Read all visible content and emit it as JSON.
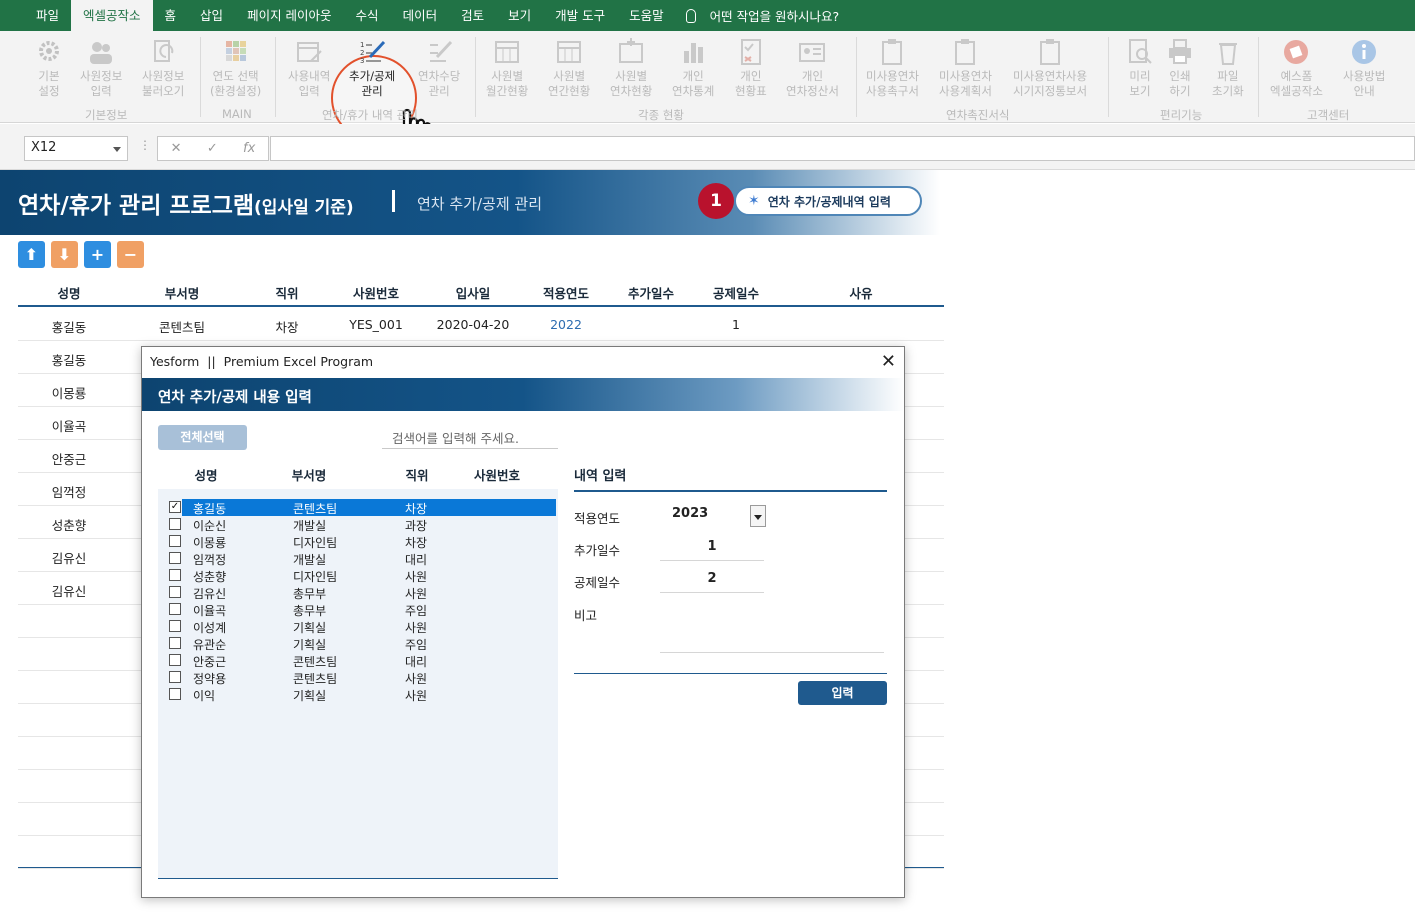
{
  "menu": {
    "tabs": [
      "파일",
      "엑셀공작소",
      "홈",
      "삽입",
      "페이지 레이아웃",
      "수식",
      "데이터",
      "검토",
      "보기",
      "개발 도구",
      "도움말"
    ],
    "tell_me": "어떤 작업을 원하시나요?"
  },
  "ribbon": {
    "btn_basic": [
      "기본",
      "설정"
    ],
    "btn_emp_input": [
      "사원정보",
      "입력"
    ],
    "btn_emp_load": [
      "사원정보",
      "불러오기"
    ],
    "btn_year": [
      "연도 선택",
      "(환경설정)"
    ],
    "btn_usage": [
      "사용내역",
      "입력"
    ],
    "btn_add": [
      "추가/공제",
      "관리"
    ],
    "btn_count": [
      "연차수당",
      "관리"
    ],
    "btn_monthly": [
      "사원별",
      "월간현황"
    ],
    "btn_yearly": [
      "사원별",
      "연간현황"
    ],
    "btn_annual": [
      "사원별",
      "연차현황"
    ],
    "btn_stats": [
      "개인",
      "연차통계"
    ],
    "btn_status": [
      "개인",
      "현황표"
    ],
    "btn_settle": [
      "개인",
      "연차정산서"
    ],
    "btn_claim": [
      "미사용연차",
      "사용촉구서"
    ],
    "btn_plan": [
      "미사용연차",
      "사용계획서"
    ],
    "btn_notice": [
      "미사용연차사용",
      "시기지정통보서"
    ],
    "btn_preview": [
      "미리",
      "보기"
    ],
    "btn_print": [
      "인쇄",
      "하기"
    ],
    "btn_reset": [
      "파일",
      "초기화"
    ],
    "btn_shop": [
      "예스폼",
      "엑셀공작소"
    ],
    "btn_guide": [
      "사용방법",
      "안내"
    ],
    "groups": {
      "basic": "기본정보",
      "main": "MAIN",
      "leave": "연차/휴가 내역 관리",
      "status": "각종 현황",
      "promo": "연차촉진서식",
      "util": "편리기능",
      "cs": "고객센터"
    }
  },
  "formula": {
    "namebox": "X12",
    "cancel": "✕",
    "enter": "✓",
    "fx": "fx",
    "value": ""
  },
  "header": {
    "title": "연차/휴가 관리 프로그램",
    "title_sub": "(입사일 기준)",
    "subtitle": "연차 추가/공제 관리",
    "badge": "1",
    "button": "연차 추가/공제내역 입력"
  },
  "icons": {
    "up": "arrow-up-icon",
    "down": "arrow-down-icon",
    "plus": "plus-icon",
    "minus": "minus-icon"
  },
  "colors": {
    "excel_green": "#217346",
    "navy": "#1f5a8e",
    "badge_red": "#b9122d",
    "callout": "#e2512c"
  },
  "table": {
    "columns": [
      "성명",
      "부서명",
      "직위",
      "사원번호",
      "입사일",
      "적용연도",
      "추가일수",
      "공제일수",
      "사유"
    ],
    "rows": [
      {
        "name": "홍길동",
        "dept": "콘텐츠팀",
        "pos": "차장",
        "id": "YES_001",
        "join": "2020-04-20",
        "year": "2022",
        "add": "",
        "sub": "1",
        "reason": ""
      },
      {
        "name": "홍길동"
      },
      {
        "name": "이몽룡"
      },
      {
        "name": "이율곡"
      },
      {
        "name": "안중근"
      },
      {
        "name": "임꺽정"
      },
      {
        "name": "성춘향"
      },
      {
        "name": "김유신"
      },
      {
        "name": "김유신"
      }
    ]
  },
  "dialog": {
    "title": "Yesform  ||  Premium Excel Program",
    "close": "✕",
    "heading": "연차 추가/공제 내용 입력",
    "select_all": "전체선택",
    "search_placeholder": "검색어를 입력해 주세요.",
    "list_columns": [
      "성명",
      "부서명",
      "직위",
      "사원번호"
    ],
    "employees": [
      {
        "name": "홍길동",
        "dept": "콘텐츠팀",
        "pos": "차장",
        "checked": true
      },
      {
        "name": "이순신",
        "dept": "개발실",
        "pos": "과장"
      },
      {
        "name": "이몽룡",
        "dept": "디자인팀",
        "pos": "차장"
      },
      {
        "name": "임꺽정",
        "dept": "개발실",
        "pos": "대리"
      },
      {
        "name": "성춘향",
        "dept": "디자인팀",
        "pos": "사원"
      },
      {
        "name": "김유신",
        "dept": "총무부",
        "pos": "사원"
      },
      {
        "name": "이율곡",
        "dept": "총무부",
        "pos": "주임"
      },
      {
        "name": "이성계",
        "dept": "기획실",
        "pos": "사원"
      },
      {
        "name": "유관순",
        "dept": "기획실",
        "pos": "주임"
      },
      {
        "name": "안중근",
        "dept": "콘텐츠팀",
        "pos": "대리"
      },
      {
        "name": "정약용",
        "dept": "콘텐츠팀",
        "pos": "사원"
      },
      {
        "name": "이익",
        "dept": "기획실",
        "pos": "사원"
      }
    ],
    "form": {
      "title": "내역 입력",
      "year_label": "적용연도",
      "year_value": "2023",
      "add_label": "추가일수",
      "add_value": "1",
      "sub_label": "공제일수",
      "sub_value": "2",
      "memo_label": "비고",
      "memo_value": "",
      "submit": "입력"
    }
  }
}
